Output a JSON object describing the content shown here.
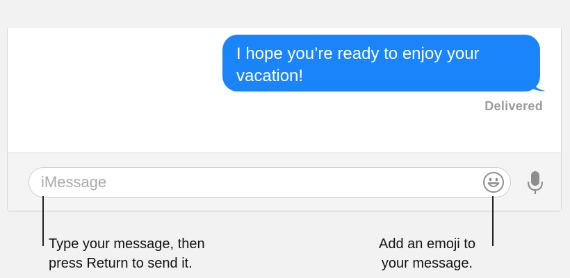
{
  "conversation": {
    "outgoing_message": "I hope you’re ready to enjoy your vacation!",
    "status": "Delivered"
  },
  "composer": {
    "placeholder": "iMessage",
    "emoji_icon": "emoji-smiley-icon",
    "mic_icon": "microphone-icon"
  },
  "callouts": {
    "left": {
      "line1": "Type your message, then",
      "line2": "press Return to send it."
    },
    "right": {
      "line1": "Add an emoji to",
      "line2": "your message."
    }
  },
  "colors": {
    "bubble": "#1a84fb",
    "status_text": "#9b9b9b"
  }
}
